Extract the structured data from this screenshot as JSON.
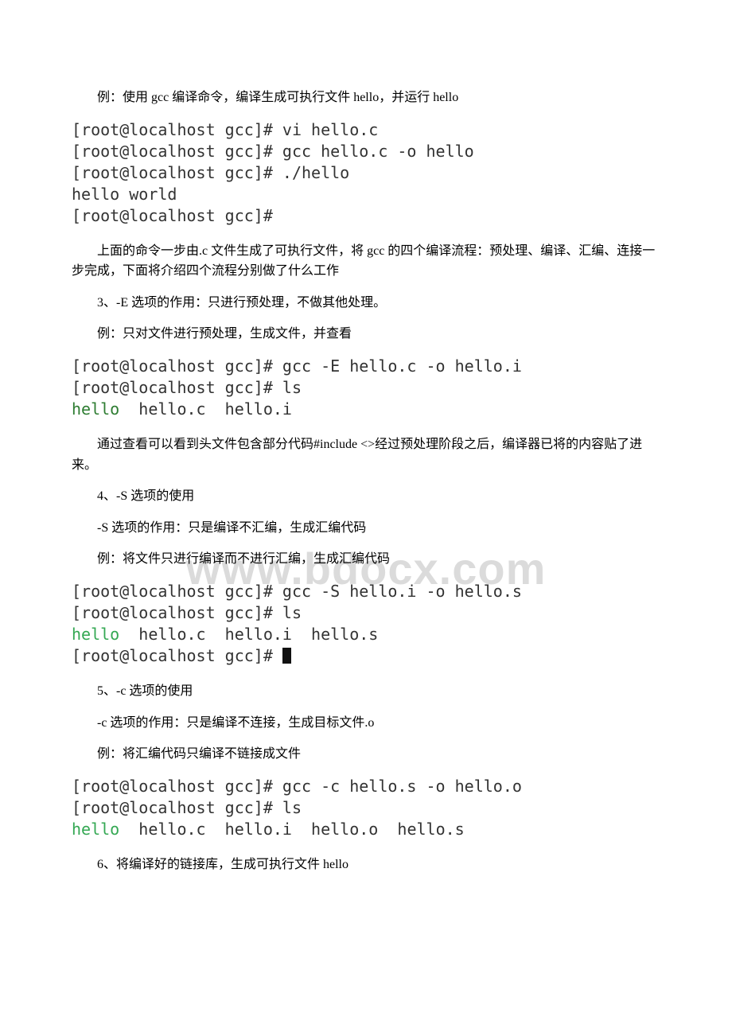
{
  "watermark": "www.bdocx.com",
  "p1": "例：使用 gcc 编译命令，编译生成可执行文件 hello，并运行 hello",
  "code1": {
    "l1": "[root@localhost gcc]# vi hello.c",
    "l2": "[root@localhost gcc]# gcc hello.c -o hello",
    "l3": "[root@localhost gcc]# ./hello",
    "l4": "hello world",
    "l5": "[root@localhost gcc]#"
  },
  "p2": "上面的命令一步由.c 文件生成了可执行文件，将 gcc 的四个编译流程：预处理、编译、汇编、连接一步完成，下面将介绍四个流程分别做了什么工作",
  "p3": "3、-E 选项的作用：只进行预处理，不做其他处理。",
  "p4": "例：只对文件进行预处理，生成文件，并查看",
  "code2": {
    "l1": "[root@localhost gcc]# gcc -E hello.c -o hello.i",
    "l2": "[root@localhost gcc]# ls",
    "l3a": "hello",
    "l3b": "  hello.c  hello.i"
  },
  "p5": "通过查看可以看到头文件包含部分代码#include <>经过预处理阶段之后，编译器已将的内容贴了进来。",
  "p6": "4、-S 选项的使用",
  "p7": "-S 选项的作用：只是编译不汇编，生成汇编代码",
  "p8": "例：将文件只进行编译而不进行汇编，生成汇编代码",
  "code3": {
    "l1": "[root@localhost gcc]# gcc -S hello.i -o hello.s",
    "l2": "[root@localhost gcc]# ls",
    "l3a": "hello",
    "l3b": "  hello.c  hello.i  hello.s",
    "l4": "[root@localhost gcc]# "
  },
  "p9": "5、-c 选项的使用",
  "p10": "-c 选项的作用：只是编译不连接，生成目标文件.o",
  "p11": "例：将汇编代码只编译不链接成文件",
  "code4": {
    "l1": "[root@localhost gcc]# gcc -c hello.s -o hello.o",
    "l2": "[root@localhost gcc]# ls",
    "l3a": "hello",
    "l3b": "  hello.c  hello.i  hello.o  hello.s"
  },
  "p12": "6、将编译好的链接库，生成可执行文件 hello"
}
